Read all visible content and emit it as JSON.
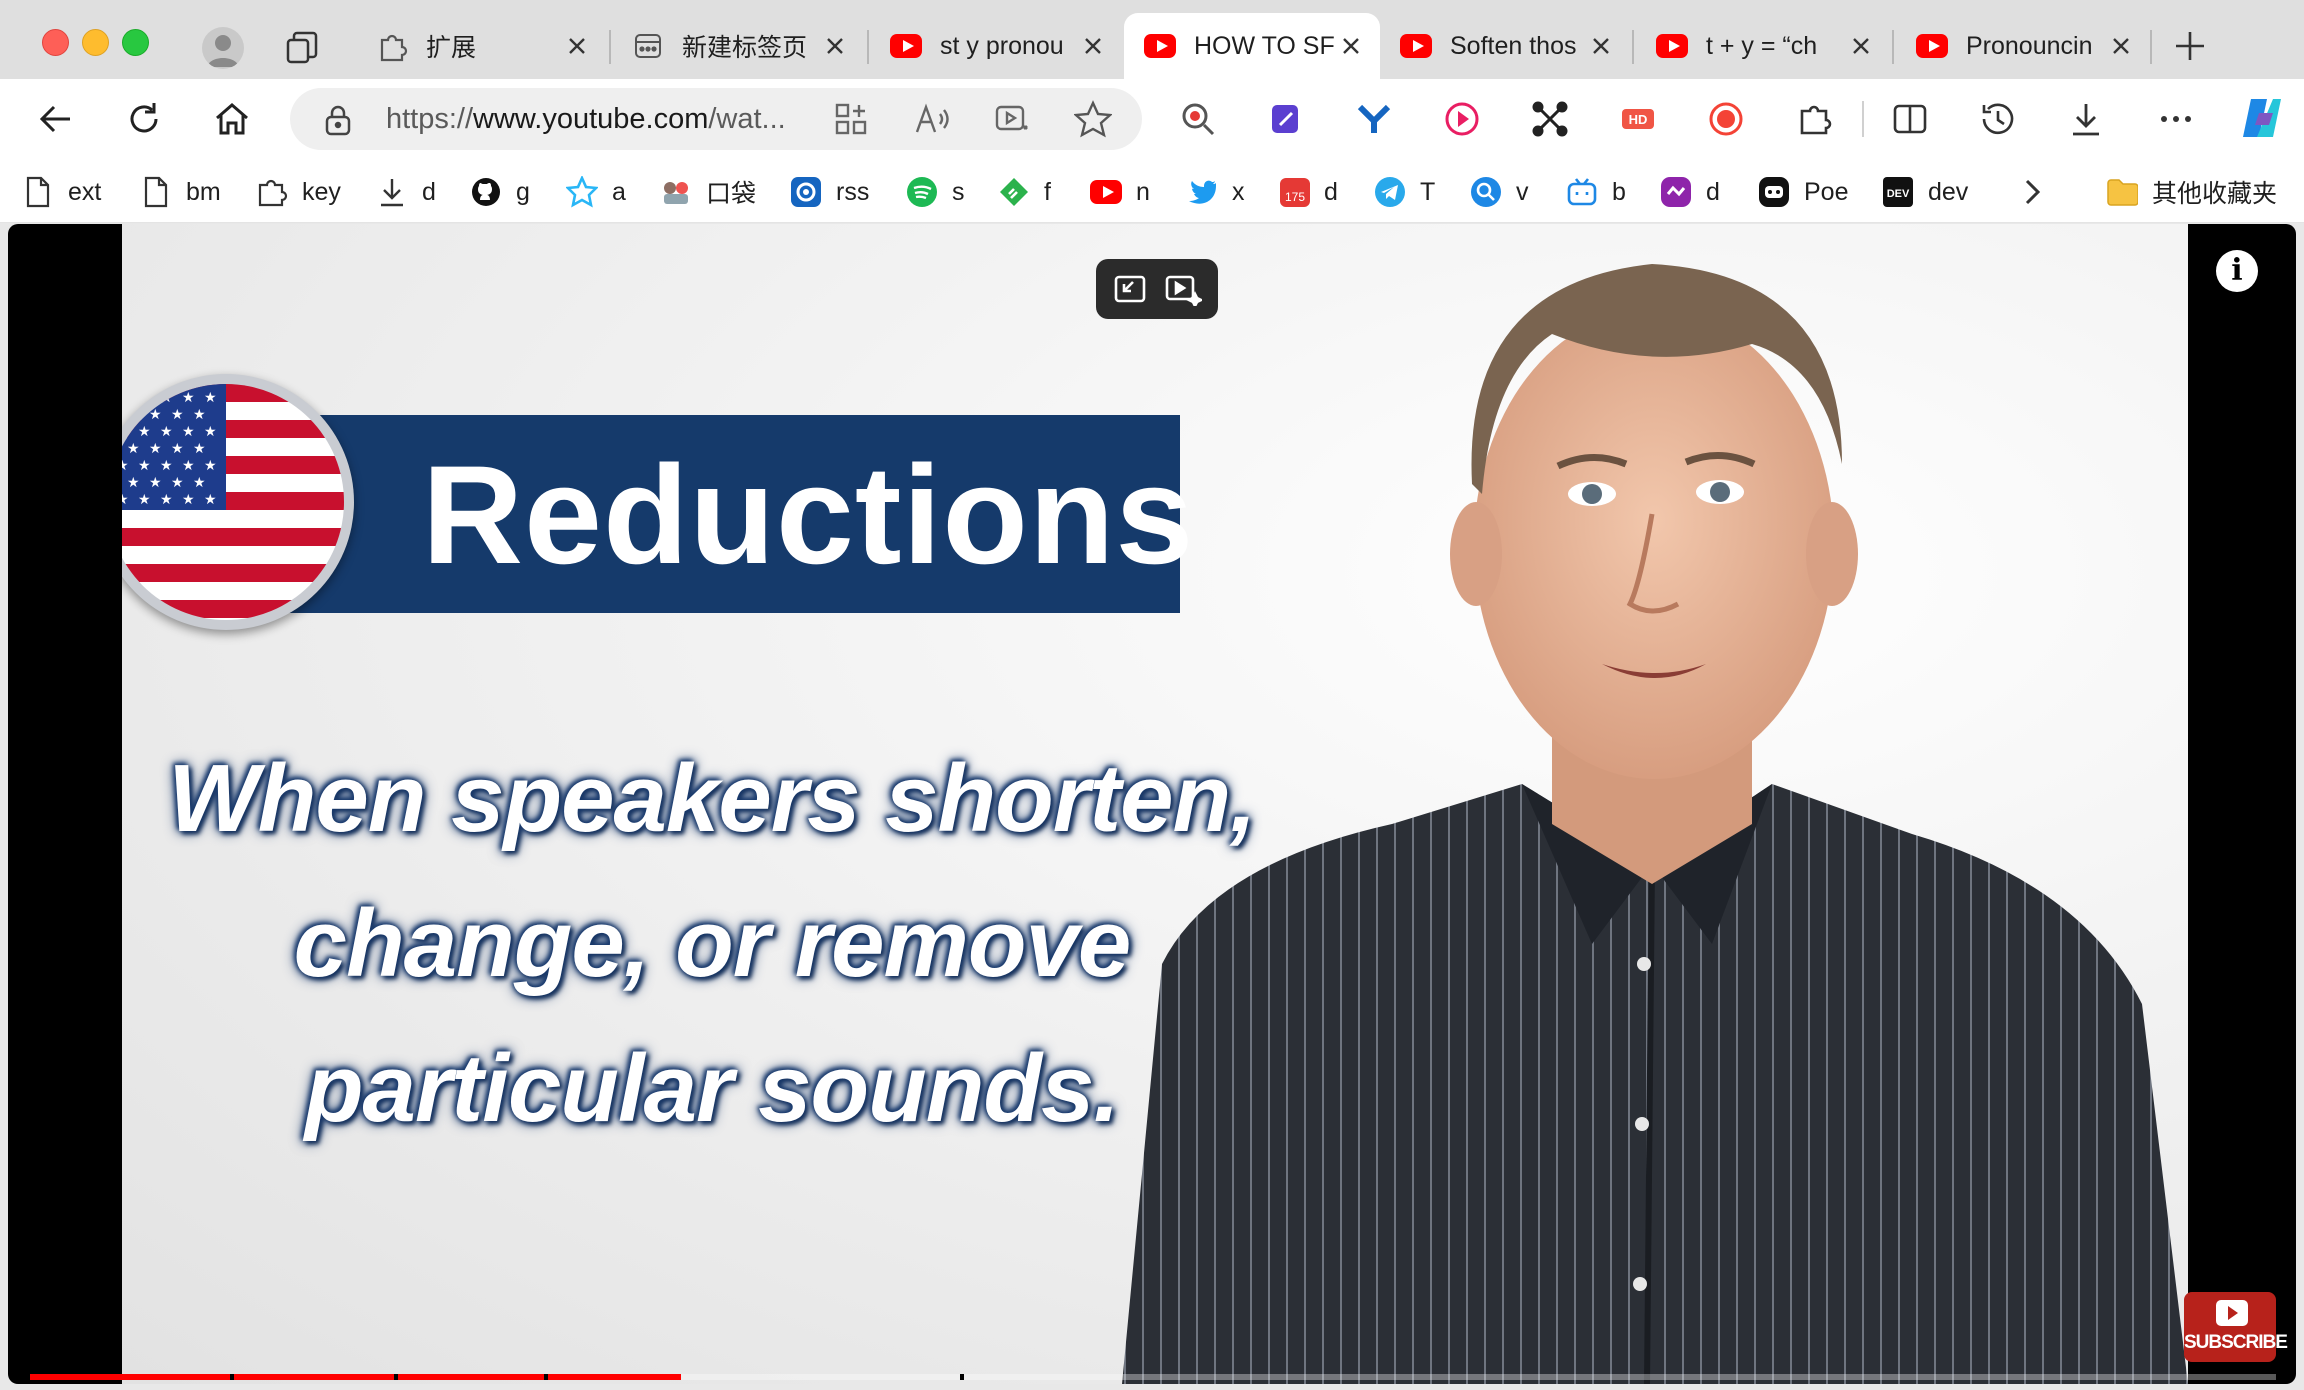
{
  "browser": {
    "tabs": [
      {
        "title": "扩展",
        "icon": "puzzle-icon"
      },
      {
        "title": "新建标签页",
        "icon": "newtab-icon"
      },
      {
        "title": "st y pronou",
        "icon": "youtube-icon"
      },
      {
        "title": "HOW TO SF",
        "icon": "youtube-icon",
        "active": true
      },
      {
        "title": "Soften thos",
        "icon": "youtube-icon"
      },
      {
        "title": "t + y = “ch",
        "icon": "youtube-icon"
      },
      {
        "title": "Pronouncin",
        "icon": "youtube-icon"
      }
    ],
    "address": {
      "prefix": "https://",
      "domain": "www.youtube.com",
      "path": "/wat..."
    },
    "bookmarks": [
      {
        "label": "ext",
        "icon": "file-icon"
      },
      {
        "label": "bm",
        "icon": "file-icon"
      },
      {
        "label": "key",
        "icon": "puzzle-icon"
      },
      {
        "label": "d",
        "icon": "download-icon"
      },
      {
        "label": "g",
        "icon": "github-icon"
      },
      {
        "label": "a",
        "icon": "star-badge-icon"
      },
      {
        "label": "口袋",
        "icon": "pocket-icon"
      },
      {
        "label": "rss",
        "icon": "rss-icon"
      },
      {
        "label": "s",
        "icon": "spotify-icon"
      },
      {
        "label": "f",
        "icon": "feedly-icon"
      },
      {
        "label": "n",
        "icon": "youtube-icon"
      },
      {
        "label": "x",
        "icon": "twitter-icon"
      },
      {
        "label": "d",
        "icon": "calendar-badge-icon",
        "badge": "175"
      },
      {
        "label": "T",
        "icon": "telegram-icon"
      },
      {
        "label": "v",
        "icon": "search-circle-icon"
      },
      {
        "label": "b",
        "icon": "bilibili-icon"
      },
      {
        "label": "d",
        "icon": "purple-app-icon"
      },
      {
        "label": "Poe",
        "icon": "poe-icon"
      },
      {
        "label": "dev",
        "icon": "dev-icon",
        "icon_text": "DEV"
      },
      {
        "label": "其他收藏夹",
        "icon": "folder-icon"
      }
    ]
  },
  "video": {
    "banner_title": "Reductions",
    "caption_lines": [
      "When speakers shorten,",
      "change, or remove",
      "particular sounds."
    ],
    "subscribe_label": "SUBSCRIBE",
    "info_label": "i",
    "progress_fraction": 0.29
  },
  "colors": {
    "banner": "#153a6b",
    "progress": "#ff0000",
    "youtube_red": "#ff0000"
  }
}
